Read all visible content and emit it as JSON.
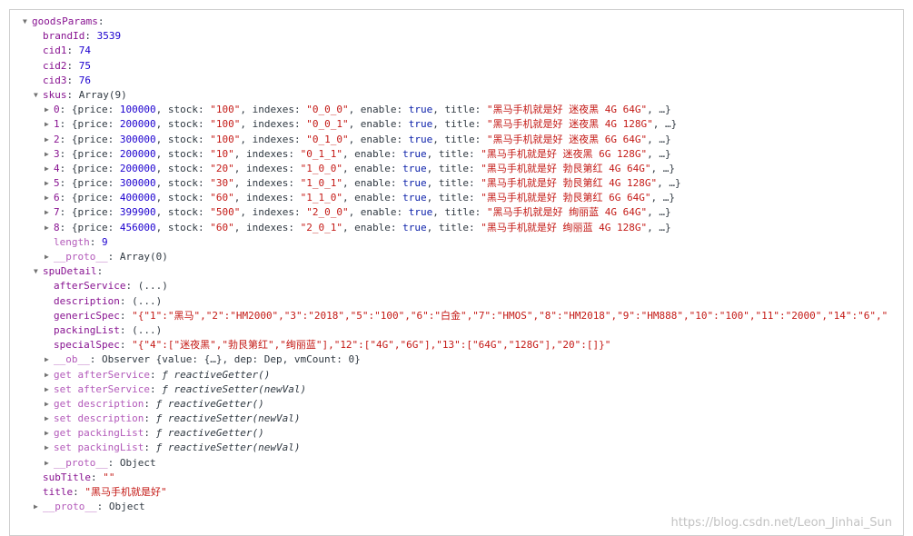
{
  "rows": [
    {
      "indent": 0,
      "arrow": "down",
      "parts": [
        {
          "t": "goodsParams",
          "c": "key"
        },
        {
          "t": ":",
          "c": "plain"
        }
      ]
    },
    {
      "indent": 1,
      "arrow": "none",
      "parts": [
        {
          "t": "brandId",
          "c": "key"
        },
        {
          "t": ": ",
          "c": "plain"
        },
        {
          "t": "3539",
          "c": "num"
        }
      ]
    },
    {
      "indent": 1,
      "arrow": "none",
      "parts": [
        {
          "t": "cid1",
          "c": "key"
        },
        {
          "t": ": ",
          "c": "plain"
        },
        {
          "t": "74",
          "c": "num"
        }
      ]
    },
    {
      "indent": 1,
      "arrow": "none",
      "parts": [
        {
          "t": "cid2",
          "c": "key"
        },
        {
          "t": ": ",
          "c": "plain"
        },
        {
          "t": "75",
          "c": "num"
        }
      ]
    },
    {
      "indent": 1,
      "arrow": "none",
      "parts": [
        {
          "t": "cid3",
          "c": "key"
        },
        {
          "t": ": ",
          "c": "plain"
        },
        {
          "t": "76",
          "c": "num"
        }
      ]
    },
    {
      "indent": 1,
      "arrow": "down",
      "parts": [
        {
          "t": "skus",
          "c": "key"
        },
        {
          "t": ": Array(9)",
          "c": "plain"
        }
      ]
    },
    {
      "indent": 2,
      "arrow": "right",
      "parts": [
        {
          "t": "0",
          "c": "key"
        },
        {
          "t": ": {price: ",
          "c": "plain"
        },
        {
          "t": "100000",
          "c": "num"
        },
        {
          "t": ", stock: ",
          "c": "plain"
        },
        {
          "t": "\"100\"",
          "c": "str"
        },
        {
          "t": ", indexes: ",
          "c": "plain"
        },
        {
          "t": "\"0_0_0\"",
          "c": "str"
        },
        {
          "t": ", enable: ",
          "c": "plain"
        },
        {
          "t": "true",
          "c": "bool"
        },
        {
          "t": ", title: ",
          "c": "plain"
        },
        {
          "t": "\"黑马手机就是好 迷夜黑 4G 64G\"",
          "c": "str"
        },
        {
          "t": ", …}",
          "c": "plain"
        }
      ]
    },
    {
      "indent": 2,
      "arrow": "right",
      "parts": [
        {
          "t": "1",
          "c": "key"
        },
        {
          "t": ": {price: ",
          "c": "plain"
        },
        {
          "t": "200000",
          "c": "num"
        },
        {
          "t": ", stock: ",
          "c": "plain"
        },
        {
          "t": "\"100\"",
          "c": "str"
        },
        {
          "t": ", indexes: ",
          "c": "plain"
        },
        {
          "t": "\"0_0_1\"",
          "c": "str"
        },
        {
          "t": ", enable: ",
          "c": "plain"
        },
        {
          "t": "true",
          "c": "bool"
        },
        {
          "t": ", title: ",
          "c": "plain"
        },
        {
          "t": "\"黑马手机就是好 迷夜黑 4G 128G\"",
          "c": "str"
        },
        {
          "t": ", …}",
          "c": "plain"
        }
      ]
    },
    {
      "indent": 2,
      "arrow": "right",
      "parts": [
        {
          "t": "2",
          "c": "key"
        },
        {
          "t": ": {price: ",
          "c": "plain"
        },
        {
          "t": "300000",
          "c": "num"
        },
        {
          "t": ", stock: ",
          "c": "plain"
        },
        {
          "t": "\"100\"",
          "c": "str"
        },
        {
          "t": ", indexes: ",
          "c": "plain"
        },
        {
          "t": "\"0_1_0\"",
          "c": "str"
        },
        {
          "t": ", enable: ",
          "c": "plain"
        },
        {
          "t": "true",
          "c": "bool"
        },
        {
          "t": ", title: ",
          "c": "plain"
        },
        {
          "t": "\"黑马手机就是好 迷夜黑 6G 64G\"",
          "c": "str"
        },
        {
          "t": ", …}",
          "c": "plain"
        }
      ]
    },
    {
      "indent": 2,
      "arrow": "right",
      "parts": [
        {
          "t": "3",
          "c": "key"
        },
        {
          "t": ": {price: ",
          "c": "plain"
        },
        {
          "t": "200000",
          "c": "num"
        },
        {
          "t": ", stock: ",
          "c": "plain"
        },
        {
          "t": "\"10\"",
          "c": "str"
        },
        {
          "t": ", indexes: ",
          "c": "plain"
        },
        {
          "t": "\"0_1_1\"",
          "c": "str"
        },
        {
          "t": ", enable: ",
          "c": "plain"
        },
        {
          "t": "true",
          "c": "bool"
        },
        {
          "t": ", title: ",
          "c": "plain"
        },
        {
          "t": "\"黑马手机就是好 迷夜黑 6G 128G\"",
          "c": "str"
        },
        {
          "t": ", …}",
          "c": "plain"
        }
      ]
    },
    {
      "indent": 2,
      "arrow": "right",
      "parts": [
        {
          "t": "4",
          "c": "key"
        },
        {
          "t": ": {price: ",
          "c": "plain"
        },
        {
          "t": "200000",
          "c": "num"
        },
        {
          "t": ", stock: ",
          "c": "plain"
        },
        {
          "t": "\"20\"",
          "c": "str"
        },
        {
          "t": ", indexes: ",
          "c": "plain"
        },
        {
          "t": "\"1_0_0\"",
          "c": "str"
        },
        {
          "t": ", enable: ",
          "c": "plain"
        },
        {
          "t": "true",
          "c": "bool"
        },
        {
          "t": ", title: ",
          "c": "plain"
        },
        {
          "t": "\"黑马手机就是好 勃艮第红 4G 64G\"",
          "c": "str"
        },
        {
          "t": ", …}",
          "c": "plain"
        }
      ]
    },
    {
      "indent": 2,
      "arrow": "right",
      "parts": [
        {
          "t": "5",
          "c": "key"
        },
        {
          "t": ": {price: ",
          "c": "plain"
        },
        {
          "t": "300000",
          "c": "num"
        },
        {
          "t": ", stock: ",
          "c": "plain"
        },
        {
          "t": "\"30\"",
          "c": "str"
        },
        {
          "t": ", indexes: ",
          "c": "plain"
        },
        {
          "t": "\"1_0_1\"",
          "c": "str"
        },
        {
          "t": ", enable: ",
          "c": "plain"
        },
        {
          "t": "true",
          "c": "bool"
        },
        {
          "t": ", title: ",
          "c": "plain"
        },
        {
          "t": "\"黑马手机就是好 勃艮第红 4G 128G\"",
          "c": "str"
        },
        {
          "t": ", …}",
          "c": "plain"
        }
      ]
    },
    {
      "indent": 2,
      "arrow": "right",
      "parts": [
        {
          "t": "6",
          "c": "key"
        },
        {
          "t": ": {price: ",
          "c": "plain"
        },
        {
          "t": "400000",
          "c": "num"
        },
        {
          "t": ", stock: ",
          "c": "plain"
        },
        {
          "t": "\"60\"",
          "c": "str"
        },
        {
          "t": ", indexes: ",
          "c": "plain"
        },
        {
          "t": "\"1_1_0\"",
          "c": "str"
        },
        {
          "t": ", enable: ",
          "c": "plain"
        },
        {
          "t": "true",
          "c": "bool"
        },
        {
          "t": ", title: ",
          "c": "plain"
        },
        {
          "t": "\"黑马手机就是好 勃艮第红 6G 64G\"",
          "c": "str"
        },
        {
          "t": ", …}",
          "c": "plain"
        }
      ]
    },
    {
      "indent": 2,
      "arrow": "right",
      "parts": [
        {
          "t": "7",
          "c": "key"
        },
        {
          "t": ": {price: ",
          "c": "plain"
        },
        {
          "t": "399900",
          "c": "num"
        },
        {
          "t": ", stock: ",
          "c": "plain"
        },
        {
          "t": "\"500\"",
          "c": "str"
        },
        {
          "t": ", indexes: ",
          "c": "plain"
        },
        {
          "t": "\"2_0_0\"",
          "c": "str"
        },
        {
          "t": ", enable: ",
          "c": "plain"
        },
        {
          "t": "true",
          "c": "bool"
        },
        {
          "t": ", title: ",
          "c": "plain"
        },
        {
          "t": "\"黑马手机就是好 绚丽蓝 4G 64G\"",
          "c": "str"
        },
        {
          "t": ", …}",
          "c": "plain"
        }
      ]
    },
    {
      "indent": 2,
      "arrow": "right",
      "parts": [
        {
          "t": "8",
          "c": "key"
        },
        {
          "t": ": {price: ",
          "c": "plain"
        },
        {
          "t": "456000",
          "c": "num"
        },
        {
          "t": ", stock: ",
          "c": "plain"
        },
        {
          "t": "\"60\"",
          "c": "str"
        },
        {
          "t": ", indexes: ",
          "c": "plain"
        },
        {
          "t": "\"2_0_1\"",
          "c": "str"
        },
        {
          "t": ", enable: ",
          "c": "plain"
        },
        {
          "t": "true",
          "c": "bool"
        },
        {
          "t": ", title: ",
          "c": "plain"
        },
        {
          "t": "\"黑马手机就是好 绚丽蓝 4G 128G\"",
          "c": "str"
        },
        {
          "t": ", …}",
          "c": "plain"
        }
      ]
    },
    {
      "indent": 2,
      "arrow": "none",
      "parts": [
        {
          "t": "length",
          "c": "key-faint"
        },
        {
          "t": ": ",
          "c": "plain"
        },
        {
          "t": "9",
          "c": "num"
        }
      ]
    },
    {
      "indent": 2,
      "arrow": "right",
      "parts": [
        {
          "t": "__proto__",
          "c": "key-faint"
        },
        {
          "t": ": Array(0)",
          "c": "plain"
        }
      ]
    },
    {
      "indent": 1,
      "arrow": "down",
      "parts": [
        {
          "t": "spuDetail",
          "c": "key"
        },
        {
          "t": ":",
          "c": "plain"
        }
      ]
    },
    {
      "indent": 2,
      "arrow": "none",
      "parts": [
        {
          "t": "afterService",
          "c": "key"
        },
        {
          "t": ": (...)",
          "c": "plain"
        }
      ]
    },
    {
      "indent": 2,
      "arrow": "none",
      "parts": [
        {
          "t": "description",
          "c": "key"
        },
        {
          "t": ": (...)",
          "c": "plain"
        }
      ]
    },
    {
      "indent": 2,
      "arrow": "none",
      "parts": [
        {
          "t": "genericSpec",
          "c": "key"
        },
        {
          "t": ": ",
          "c": "plain"
        },
        {
          "t": "\"{\"1\":\"黑马\",\"2\":\"HM2000\",\"3\":\"2018\",\"5\":\"100\",\"6\":\"白金\",\"7\":\"HMOS\",\"8\":\"HM2018\",\"9\":\"HM888\",\"10\":\"100\",\"11\":\"2000\",\"14\":\"6\",\"",
          "c": "str"
        }
      ]
    },
    {
      "indent": 2,
      "arrow": "none",
      "parts": [
        {
          "t": "packingList",
          "c": "key"
        },
        {
          "t": ": (...)",
          "c": "plain"
        }
      ]
    },
    {
      "indent": 2,
      "arrow": "none",
      "parts": [
        {
          "t": "specialSpec",
          "c": "key"
        },
        {
          "t": ": ",
          "c": "plain"
        },
        {
          "t": "\"{\"4\":[\"迷夜黑\",\"勃艮第红\",\"绚丽蓝\"],\"12\":[\"4G\",\"6G\"],\"13\":[\"64G\",\"128G\"],\"20\":[]}\"",
          "c": "str"
        }
      ]
    },
    {
      "indent": 2,
      "arrow": "right",
      "parts": [
        {
          "t": "__ob__",
          "c": "key-faint"
        },
        {
          "t": ": Observer {value: {…}, dep: Dep, vmCount: 0}",
          "c": "plain"
        }
      ]
    },
    {
      "indent": 2,
      "arrow": "right",
      "parts": [
        {
          "t": "get afterService",
          "c": "key-faint"
        },
        {
          "t": ": ",
          "c": "plain"
        },
        {
          "t": "ƒ reactiveGetter()",
          "c": "fn"
        }
      ]
    },
    {
      "indent": 2,
      "arrow": "right",
      "parts": [
        {
          "t": "set afterService",
          "c": "key-faint"
        },
        {
          "t": ": ",
          "c": "plain"
        },
        {
          "t": "ƒ reactiveSetter(newVal)",
          "c": "fn"
        }
      ]
    },
    {
      "indent": 2,
      "arrow": "right",
      "parts": [
        {
          "t": "get description",
          "c": "key-faint"
        },
        {
          "t": ": ",
          "c": "plain"
        },
        {
          "t": "ƒ reactiveGetter()",
          "c": "fn"
        }
      ]
    },
    {
      "indent": 2,
      "arrow": "right",
      "parts": [
        {
          "t": "set description",
          "c": "key-faint"
        },
        {
          "t": ": ",
          "c": "plain"
        },
        {
          "t": "ƒ reactiveSetter(newVal)",
          "c": "fn"
        }
      ]
    },
    {
      "indent": 2,
      "arrow": "right",
      "parts": [
        {
          "t": "get packingList",
          "c": "key-faint"
        },
        {
          "t": ": ",
          "c": "plain"
        },
        {
          "t": "ƒ reactiveGetter()",
          "c": "fn"
        }
      ]
    },
    {
      "indent": 2,
      "arrow": "right",
      "parts": [
        {
          "t": "set packingList",
          "c": "key-faint"
        },
        {
          "t": ": ",
          "c": "plain"
        },
        {
          "t": "ƒ reactiveSetter(newVal)",
          "c": "fn"
        }
      ]
    },
    {
      "indent": 2,
      "arrow": "right",
      "parts": [
        {
          "t": "__proto__",
          "c": "key-faint"
        },
        {
          "t": ": Object",
          "c": "plain"
        }
      ]
    },
    {
      "indent": 1,
      "arrow": "none",
      "parts": [
        {
          "t": "subTitle",
          "c": "key"
        },
        {
          "t": ": ",
          "c": "plain"
        },
        {
          "t": "\"\"",
          "c": "str"
        }
      ]
    },
    {
      "indent": 1,
      "arrow": "none",
      "parts": [
        {
          "t": "title",
          "c": "key"
        },
        {
          "t": ": ",
          "c": "plain"
        },
        {
          "t": "\"黑马手机就是好\"",
          "c": "str"
        }
      ]
    },
    {
      "indent": 1,
      "arrow": "right",
      "parts": [
        {
          "t": "__proto__",
          "c": "key-faint"
        },
        {
          "t": ": Object",
          "c": "plain"
        }
      ]
    }
  ],
  "icons": {
    "down": "▼",
    "right": "▶"
  },
  "watermark": "https://blog.csdn.net/Leon_Jinhai_Sun"
}
